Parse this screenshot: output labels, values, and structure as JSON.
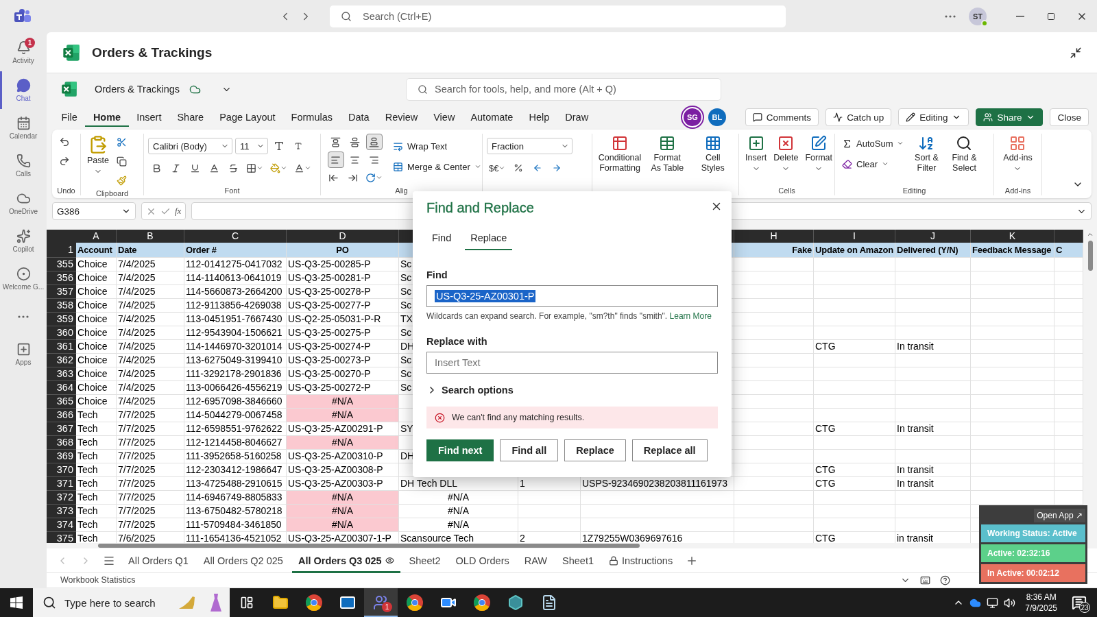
{
  "teams": {
    "search_placeholder": "Search (Ctrl+E)",
    "user_initials": "ST",
    "rail": [
      {
        "label": "Activity",
        "badge": "1",
        "selected": false
      },
      {
        "label": "Chat",
        "selected": true
      },
      {
        "label": "Calendar",
        "selected": false
      },
      {
        "label": "Calls",
        "selected": false
      },
      {
        "label": "OneDrive",
        "selected": false
      },
      {
        "label": "Copilot",
        "selected": false
      },
      {
        "label": "Welcome G...",
        "selected": false
      }
    ],
    "apps_label": "Apps"
  },
  "app_title": "Orders & Trackings",
  "workbook": {
    "name": "Orders & Trackings",
    "search_placeholder": "Search for tools, help, and more (Alt + Q)",
    "menu": [
      {
        "label": "File",
        "selected": false
      },
      {
        "label": "Home",
        "selected": true
      },
      {
        "label": "Insert",
        "selected": false
      },
      {
        "label": "Share",
        "selected": false
      },
      {
        "label": "Page Layout",
        "selected": false
      },
      {
        "label": "Formulas",
        "selected": false
      },
      {
        "label": "Data",
        "selected": false
      },
      {
        "label": "Review",
        "selected": false
      },
      {
        "label": "View",
        "selected": false
      },
      {
        "label": "Automate",
        "selected": false
      },
      {
        "label": "Help",
        "selected": false
      },
      {
        "label": "Draw",
        "selected": false
      }
    ],
    "collaborators": [
      {
        "initials": "SG",
        "color": "#7b1fa2"
      },
      {
        "initials": "BL",
        "color": "#0f6cbd"
      }
    ],
    "buttons": [
      {
        "label": "Comments",
        "kind": "comments"
      },
      {
        "label": "Catch up",
        "kind": "catchup"
      },
      {
        "label": "Editing",
        "kind": "editing"
      },
      {
        "label": "Share",
        "kind": "share"
      },
      {
        "label": "Close",
        "kind": "close"
      }
    ]
  },
  "ribbon": {
    "undo_label": "Undo",
    "clipboard": {
      "paste": "Paste",
      "label": "Clipboard"
    },
    "font": {
      "family": "Calibri (Body)",
      "size": "11",
      "label": "Font"
    },
    "alignment": {
      "vertical": [
        {
          "selected": false
        },
        {
          "selected": false
        },
        {
          "selected": true
        }
      ],
      "horizontal": [
        {
          "selected": true
        },
        {
          "selected": false
        },
        {
          "selected": false
        }
      ],
      "wrap": "Wrap Text",
      "merge": "Merge & Center",
      "label": "Alig"
    },
    "number": {
      "format": "Fraction",
      "currency": "$€"
    },
    "styles": [
      "Conditional Formatting",
      "Format As Table",
      "Cell Styles"
    ],
    "cells": {
      "items": [
        "Insert",
        "Delete",
        "Format"
      ],
      "label": "Cells"
    },
    "editing": {
      "autosum": "AutoSum",
      "clear": "Clear",
      "sort": "Sort & Filter",
      "find": "Find & Select",
      "label": "Editing"
    },
    "addins": {
      "item": "Add-ins",
      "label": "Add-ins"
    }
  },
  "formula_bar": {
    "cell": "G386",
    "fx": "fx"
  },
  "grid": {
    "column_letters": {
      "A": "A",
      "B": "B",
      "C": "C",
      "D": "D",
      "H": "H",
      "I": "I",
      "J": "J",
      "K": "K"
    },
    "header_row": {
      "number": "1",
      "A": "Account",
      "B": "Date",
      "C": "Order #",
      "D": "PO",
      "H": "Fake",
      "I": "Update on Amazon",
      "J": "Delivered (Y/N)",
      "K": "Feedback Message",
      "L": "C"
    },
    "rows": [
      {
        "number": "355",
        "A": "Choice",
        "B": "7/4/2025",
        "C": "112-0141275-0417032",
        "D": "US-Q3-25-00285-P",
        "E": "Sc",
        "error": false
      },
      {
        "number": "356",
        "A": "Choice",
        "B": "7/4/2025",
        "C": "114-1140613-0641019",
        "D": "US-Q3-25-00281-P",
        "E": "Sc",
        "error": false
      },
      {
        "number": "357",
        "A": "Choice",
        "B": "7/4/2025",
        "C": "114-5660873-2664200",
        "D": "US-Q3-25-00278-P",
        "E": "Sc",
        "error": false
      },
      {
        "number": "358",
        "A": "Choice",
        "B": "7/4/2025",
        "C": "112-9113856-4269038",
        "D": "US-Q3-25-00277-P",
        "E": "Sc",
        "error": false
      },
      {
        "number": "359",
        "A": "Choice",
        "B": "7/4/2025",
        "C": "113-0451951-7667430",
        "D": "US-Q2-25-05031-P-R",
        "E": "TX",
        "error": false
      },
      {
        "number": "360",
        "A": "Choice",
        "B": "7/4/2025",
        "C": "112-9543904-1506621",
        "D": "US-Q3-25-00275-P",
        "E": "Sc",
        "error": false
      },
      {
        "number": "361",
        "A": "Choice",
        "B": "7/4/2025",
        "C": "114-1446970-3201014",
        "D": "US-Q3-25-00274-P",
        "E": "DH",
        "I": "CTG",
        "J": "In transit",
        "error": false
      },
      {
        "number": "362",
        "A": "Choice",
        "B": "7/4/2025",
        "C": "113-6275049-3199410",
        "D": "US-Q3-25-00273-P",
        "E": "Sc",
        "error": false
      },
      {
        "number": "363",
        "A": "Choice",
        "B": "7/4/2025",
        "C": "111-3292178-2901836",
        "D": "US-Q3-25-00270-P",
        "E": "Sc",
        "error": false
      },
      {
        "number": "364",
        "A": "Choice",
        "B": "7/4/2025",
        "C": "113-0066426-4556219",
        "D": "US-Q3-25-00272-P",
        "E": "Sc",
        "error": false
      },
      {
        "number": "365",
        "A": "Choice",
        "B": "7/4/2025",
        "C": "112-6957098-3846660",
        "D": "#N/A",
        "error": true
      },
      {
        "number": "366",
        "A": "Tech",
        "B": "7/7/2025",
        "C": "114-5044279-0067458",
        "D": "#N/A",
        "error": true
      },
      {
        "number": "367",
        "A": "Tech",
        "B": "7/7/2025",
        "C": "112-6598551-9762622",
        "D": "US-Q3-25-AZ00291-P",
        "E": "SY",
        "I": "CTG",
        "J": "In transit",
        "error": false
      },
      {
        "number": "368",
        "A": "Tech",
        "B": "7/7/2025",
        "C": "112-1214458-8046627",
        "D": "#N/A",
        "error": true
      },
      {
        "number": "369",
        "A": "Tech",
        "B": "7/7/2025",
        "C": "111-3952658-5160258",
        "D": "US-Q3-25-AZ00310-P",
        "E": "DH",
        "error": false
      },
      {
        "number": "370",
        "A": "Tech",
        "B": "7/7/2025",
        "C": "112-2303412-1986647",
        "D": "US-Q3-25-AZ00308-P",
        "I": "CTG",
        "J": "In transit",
        "error": false
      },
      {
        "number": "371",
        "A": "Tech",
        "B": "7/7/2025",
        "C": "113-4725488-2910615",
        "D": "US-Q3-25-AZ00303-P",
        "E": "DH Tech DLL",
        "F": "1",
        "G": "USPS-9234690238203811161973",
        "I": "CTG",
        "J": "In transit",
        "error": false
      },
      {
        "number": "372",
        "A": "Tech",
        "B": "7/7/2025",
        "C": "114-6946749-8805833",
        "D": "#N/A",
        "E": "#N/A",
        "error": true
      },
      {
        "number": "373",
        "A": "Tech",
        "B": "7/7/2025",
        "C": "113-6750482-5780218",
        "D": "#N/A",
        "E": "#N/A",
        "error": true
      },
      {
        "number": "374",
        "A": "Tech",
        "B": "7/7/2025",
        "C": "111-5709484-3461850",
        "D": "#N/A",
        "E": "#N/A",
        "error": true
      },
      {
        "number": "375",
        "A": "Tech",
        "B": "7/6/2025",
        "C": "111-1654136-4521052",
        "D": "US-Q3-25-AZ00307-1-P",
        "E": "Scansource Tech",
        "F": "2",
        "G": "1Z79255W0369697616",
        "I": "CTG",
        "J": "in transit",
        "error": false
      }
    ]
  },
  "dialog": {
    "title": "Find and Replace",
    "tabs": [
      {
        "label": "Find",
        "selected": false
      },
      {
        "label": "Replace",
        "selected": true
      }
    ],
    "find_label": "Find",
    "find_value": "US-Q3-25-AZ00301-P",
    "find_value_highlighted": true,
    "hint": "Wildcards can expand search. For example, \"sm?th\" finds \"smith\".",
    "hint_link": "Learn More",
    "replace_label": "Replace with",
    "replace_placeholder": "Insert Text",
    "search_options": {
      "label": "Search options",
      "expanded": false
    },
    "error": "We can't find any matching results.",
    "buttons": [
      {
        "label": "Find next",
        "kind": "primary"
      },
      {
        "label": "Find all",
        "kind": "secondary"
      },
      {
        "label": "Replace",
        "kind": "secondary"
      },
      {
        "label": "Replace all",
        "kind": "secondary"
      }
    ]
  },
  "sheet_tabs": [
    {
      "label": "All Orders Q1",
      "selected": false,
      "kind": "plain"
    },
    {
      "label": "All Orders Q2 025",
      "selected": false,
      "kind": "plain"
    },
    {
      "label": "All Orders Q3 025",
      "selected": true,
      "kind": "watched"
    },
    {
      "label": "Sheet2",
      "selected": false,
      "kind": "plain"
    },
    {
      "label": "OLD Orders",
      "selected": false,
      "kind": "plain"
    },
    {
      "label": "RAW",
      "selected": false,
      "kind": "plain"
    },
    {
      "label": "Sheet1",
      "selected": false,
      "kind": "plain"
    },
    {
      "label": "Instructions",
      "selected": false,
      "kind": "locked"
    }
  ],
  "status_bar": {
    "text": "Workbook Statistics"
  },
  "tracker": {
    "open_app": "Open App ↗",
    "rows": [
      {
        "label": "Working Status: Active",
        "color": "#5bbfcc"
      },
      {
        "label": "Active: 02:32:16",
        "color": "#5cd08a"
      },
      {
        "label": "In Active: 00:02:12",
        "color": "#e8715f"
      }
    ]
  },
  "taskbar": {
    "search_placeholder": "Type here to search",
    "teams_badge": "1",
    "time": "8:36 AM",
    "date": "7/9/2025",
    "notifications": "23"
  }
}
